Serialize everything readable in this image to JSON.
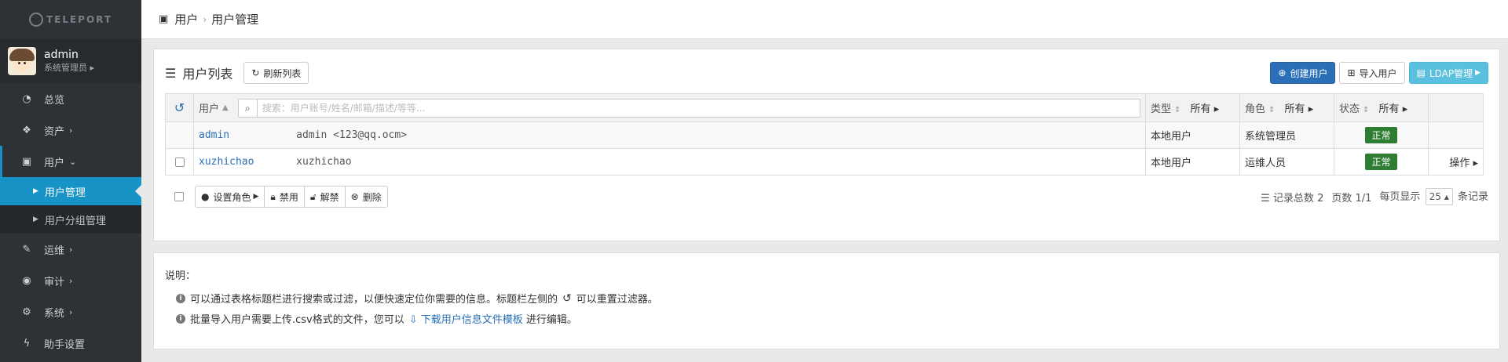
{
  "app": {
    "logo": "TELEPORT"
  },
  "profile": {
    "name": "admin",
    "role": "系统管理员"
  },
  "sidebar": {
    "items": [
      {
        "label": "总览",
        "icon": "dashboard-icon"
      },
      {
        "label": "资产",
        "icon": "cubes-icon",
        "chev": "›"
      },
      {
        "label": "用户",
        "icon": "user-card-icon",
        "chev": "⌄"
      },
      {
        "label": "运维",
        "icon": "wrench-icon",
        "chev": "›"
      },
      {
        "label": "审计",
        "icon": "eye-icon",
        "chev": "›"
      },
      {
        "label": "系统",
        "icon": "gear-icon",
        "chev": "›"
      },
      {
        "label": "助手设置",
        "icon": "bolt-icon"
      }
    ],
    "sub": [
      {
        "label": "用户管理"
      },
      {
        "label": "用户分组管理"
      }
    ]
  },
  "breadcrumb": {
    "root": "用户",
    "current": "用户管理"
  },
  "list": {
    "title": "用户列表",
    "refresh_label": "刷新列表",
    "create_label": "创建用户",
    "import_label": "导入用户",
    "ldap_label": "LDAP管理",
    "search_placeholder": "搜索：用户账号/姓名/邮箱/描述/等等...",
    "headers": {
      "user": "用户",
      "type": "类型",
      "role": "角色",
      "status": "状态",
      "all": "所有"
    },
    "rows": [
      {
        "account": "admin",
        "display": "admin <123@qq.ocm>",
        "type": "本地用户",
        "role": "系统管理员",
        "status": "正常",
        "action": ""
      },
      {
        "account": "xuzhichao",
        "display": "xuzhichao",
        "type": "本地用户",
        "role": "运维人员",
        "status": "正常",
        "action": "操作"
      }
    ],
    "batch": {
      "set_role": "设置角色",
      "disable": "禁用",
      "unlock": "解禁",
      "delete": "删除"
    },
    "pager": {
      "total_label": "记录总数",
      "total": "2",
      "page_label": "页数",
      "page": "1/1",
      "per_page_label": "每页显示",
      "page_size": "25",
      "records_label": "条记录"
    }
  },
  "notes": {
    "title": "说明：",
    "line1_a": "可以通过表格标题栏进行搜索或过滤，以便快速定位你需要的信息。标题栏左侧的",
    "line1_b": "可以重置过滤器。",
    "line2_a": "批量导入用户需要上传.csv格式的文件，您可以",
    "line2_link": "下载用户信息文件模板",
    "line2_b": "进行编辑。"
  },
  "colors": {
    "primary": "#2a6fb8",
    "info": "#5bc0de",
    "sidebar": "#2d3237",
    "active": "#1793c6",
    "success": "#2f7d32"
  }
}
